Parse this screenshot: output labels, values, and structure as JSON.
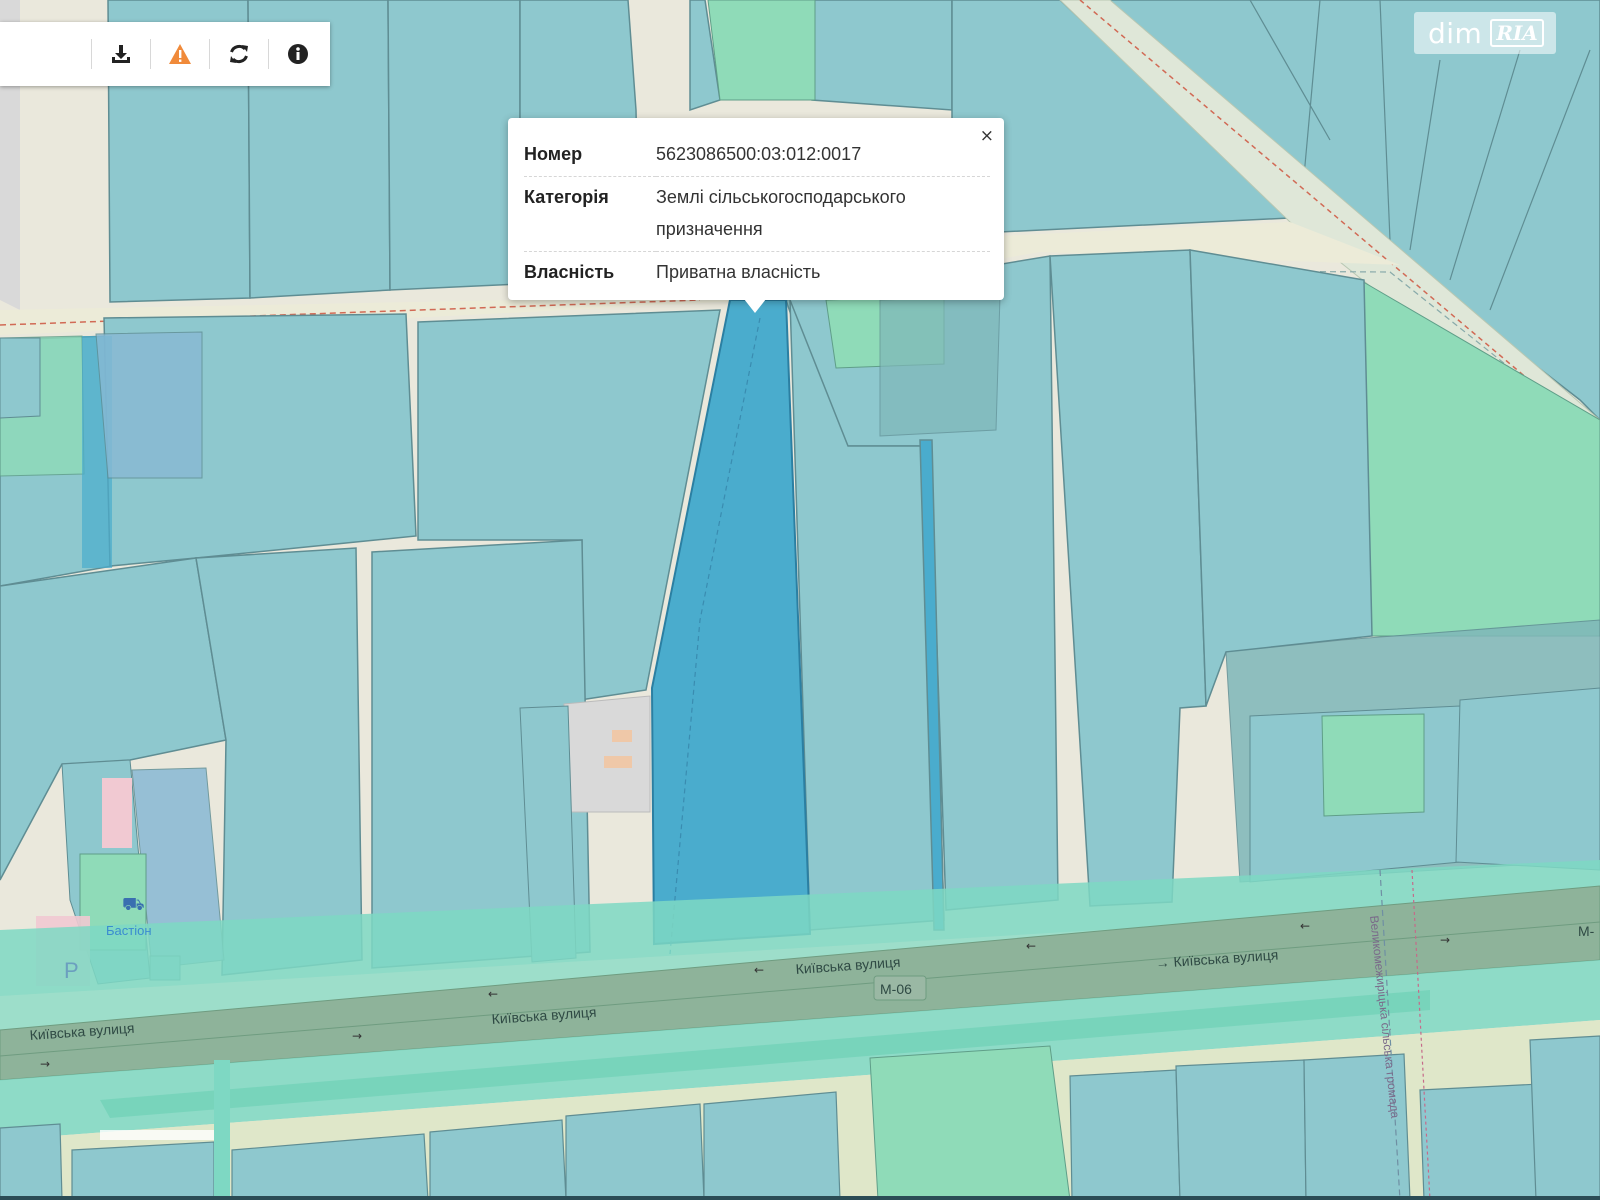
{
  "toolbar": {
    "search_placeholder": "",
    "buttons": [
      {
        "icon": "download-icon",
        "glyph": "⬇"
      },
      {
        "icon": "warning-icon",
        "glyph": "⚠"
      },
      {
        "icon": "refresh-icon",
        "glyph": "⟳"
      },
      {
        "icon": "info-icon",
        "glyph": "i"
      }
    ]
  },
  "logo": {
    "dim": "dim",
    "ria": "RIA"
  },
  "popup": {
    "close": "×",
    "rows": [
      {
        "key": "Номер",
        "value": "5623086500:03:012:0017"
      },
      {
        "key": "Категорія",
        "value": "Землі сільськогосподарського призначення"
      },
      {
        "key": "Власність",
        "value": "Приватна власність"
      }
    ]
  },
  "map": {
    "streets": [
      {
        "label": "Київська вулиця"
      },
      {
        "label": "Київська вулиця"
      },
      {
        "label": "→ Київська вулиця"
      },
      {
        "label": "Київська вулиця →"
      }
    ],
    "road_shield": "M-06",
    "road_shield_edge": "M-",
    "poi_label": "Бастіон",
    "parking": "P",
    "community_label": "Великомежиріцька сільська громада"
  },
  "colors": {
    "parcel": "#8ec8ce",
    "parcel_selected": "#4aaccd",
    "green_zone": "#8fdbb8",
    "road": "#8eb39a",
    "road_band": "#7ed8c3",
    "background": "#eae8dc",
    "accent_warning": "#f08a3a"
  }
}
